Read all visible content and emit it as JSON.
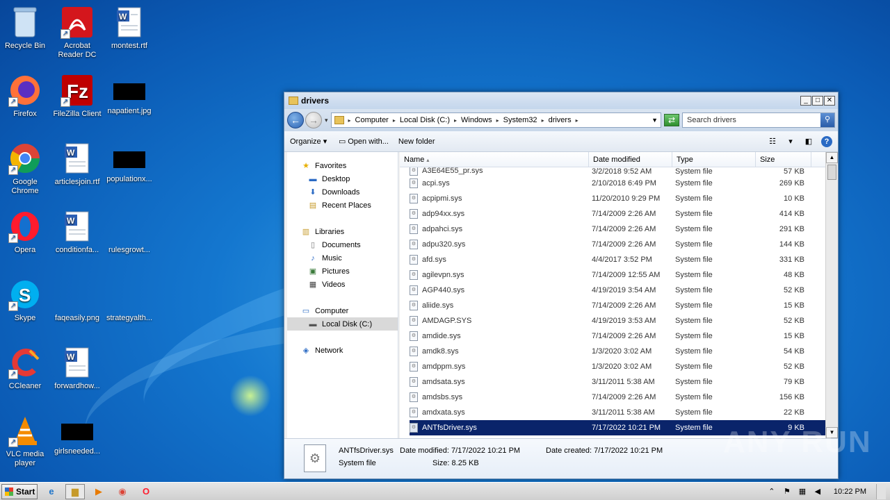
{
  "desktop": {
    "icons": [
      {
        "label": "Recycle Bin"
      },
      {
        "label": "Acrobat Reader DC"
      },
      {
        "label": "montest.rtf"
      },
      {
        "label": "Firefox"
      },
      {
        "label": "FileZilla Client"
      },
      {
        "label": "napatient.jpg"
      },
      {
        "label": "Google Chrome"
      },
      {
        "label": "articlesjoin.rtf"
      },
      {
        "label": "populationx..."
      },
      {
        "label": "Opera"
      },
      {
        "label": "conditionfa..."
      },
      {
        "label": "rulesgrowt..."
      },
      {
        "label": "Skype"
      },
      {
        "label": "faqeasily.png"
      },
      {
        "label": "strategyalth..."
      },
      {
        "label": "CCleaner"
      },
      {
        "label": "forwardhow..."
      },
      {
        "label": "VLC media player"
      },
      {
        "label": "girlsneeded..."
      }
    ]
  },
  "window": {
    "title": "drivers",
    "min": "_",
    "max": "□",
    "close": "✕"
  },
  "address": {
    "crumbs": [
      "Computer",
      "Local Disk (C:)",
      "Windows",
      "System32",
      "drivers"
    ],
    "search_placeholder": "Search drivers"
  },
  "toolbar": {
    "organize": "Organize",
    "open_with": "Open with...",
    "new_folder": "New folder"
  },
  "nav": {
    "favorites": "Favorites",
    "desktop": "Desktop",
    "downloads": "Downloads",
    "recent": "Recent Places",
    "libraries": "Libraries",
    "documents": "Documents",
    "music": "Music",
    "pictures": "Pictures",
    "videos": "Videos",
    "computer": "Computer",
    "localdisk": "Local Disk (C:)",
    "network": "Network"
  },
  "columns": {
    "name": "Name",
    "date": "Date modified",
    "type": "Type",
    "size": "Size"
  },
  "files": [
    {
      "name": "A3E64E55_pr.sys",
      "date": "3/2/2018 9:52 AM",
      "type": "System file",
      "size": "57 KB"
    },
    {
      "name": "acpi.sys",
      "date": "2/10/2018 6:49 PM",
      "type": "System file",
      "size": "269 KB"
    },
    {
      "name": "acpipmi.sys",
      "date": "11/20/2010 9:29 PM",
      "type": "System file",
      "size": "10 KB"
    },
    {
      "name": "adp94xx.sys",
      "date": "7/14/2009 2:26 AM",
      "type": "System file",
      "size": "414 KB"
    },
    {
      "name": "adpahci.sys",
      "date": "7/14/2009 2:26 AM",
      "type": "System file",
      "size": "291 KB"
    },
    {
      "name": "adpu320.sys",
      "date": "7/14/2009 2:26 AM",
      "type": "System file",
      "size": "144 KB"
    },
    {
      "name": "afd.sys",
      "date": "4/4/2017 3:52 PM",
      "type": "System file",
      "size": "331 KB"
    },
    {
      "name": "agilevpn.sys",
      "date": "7/14/2009 12:55 AM",
      "type": "System file",
      "size": "48 KB"
    },
    {
      "name": "AGP440.sys",
      "date": "4/19/2019 3:54 AM",
      "type": "System file",
      "size": "52 KB"
    },
    {
      "name": "aliide.sys",
      "date": "7/14/2009 2:26 AM",
      "type": "System file",
      "size": "15 KB"
    },
    {
      "name": "AMDAGP.SYS",
      "date": "4/19/2019 3:53 AM",
      "type": "System file",
      "size": "52 KB"
    },
    {
      "name": "amdide.sys",
      "date": "7/14/2009 2:26 AM",
      "type": "System file",
      "size": "15 KB"
    },
    {
      "name": "amdk8.sys",
      "date": "1/3/2020 3:02 AM",
      "type": "System file",
      "size": "54 KB"
    },
    {
      "name": "amdppm.sys",
      "date": "1/3/2020 3:02 AM",
      "type": "System file",
      "size": "52 KB"
    },
    {
      "name": "amdsata.sys",
      "date": "3/11/2011 5:38 AM",
      "type": "System file",
      "size": "79 KB"
    },
    {
      "name": "amdsbs.sys",
      "date": "7/14/2009 2:26 AM",
      "type": "System file",
      "size": "156 KB"
    },
    {
      "name": "amdxata.sys",
      "date": "3/11/2011 5:38 AM",
      "type": "System file",
      "size": "22 KB"
    },
    {
      "name": "ANTfsDriver.sys",
      "date": "7/17/2022 10:21 PM",
      "type": "System file",
      "size": "9 KB"
    }
  ],
  "details": {
    "name": "ANTfsDriver.sys",
    "type": "System file",
    "modified_label": "Date modified:",
    "modified": "7/17/2022 10:21 PM",
    "created_label": "Date created:",
    "created": "7/17/2022 10:21 PM",
    "size_label": "Size:",
    "size": "8.25 KB"
  },
  "taskbar": {
    "start": "Start",
    "time": "10:22 PM"
  },
  "watermark": "ANY RUN"
}
